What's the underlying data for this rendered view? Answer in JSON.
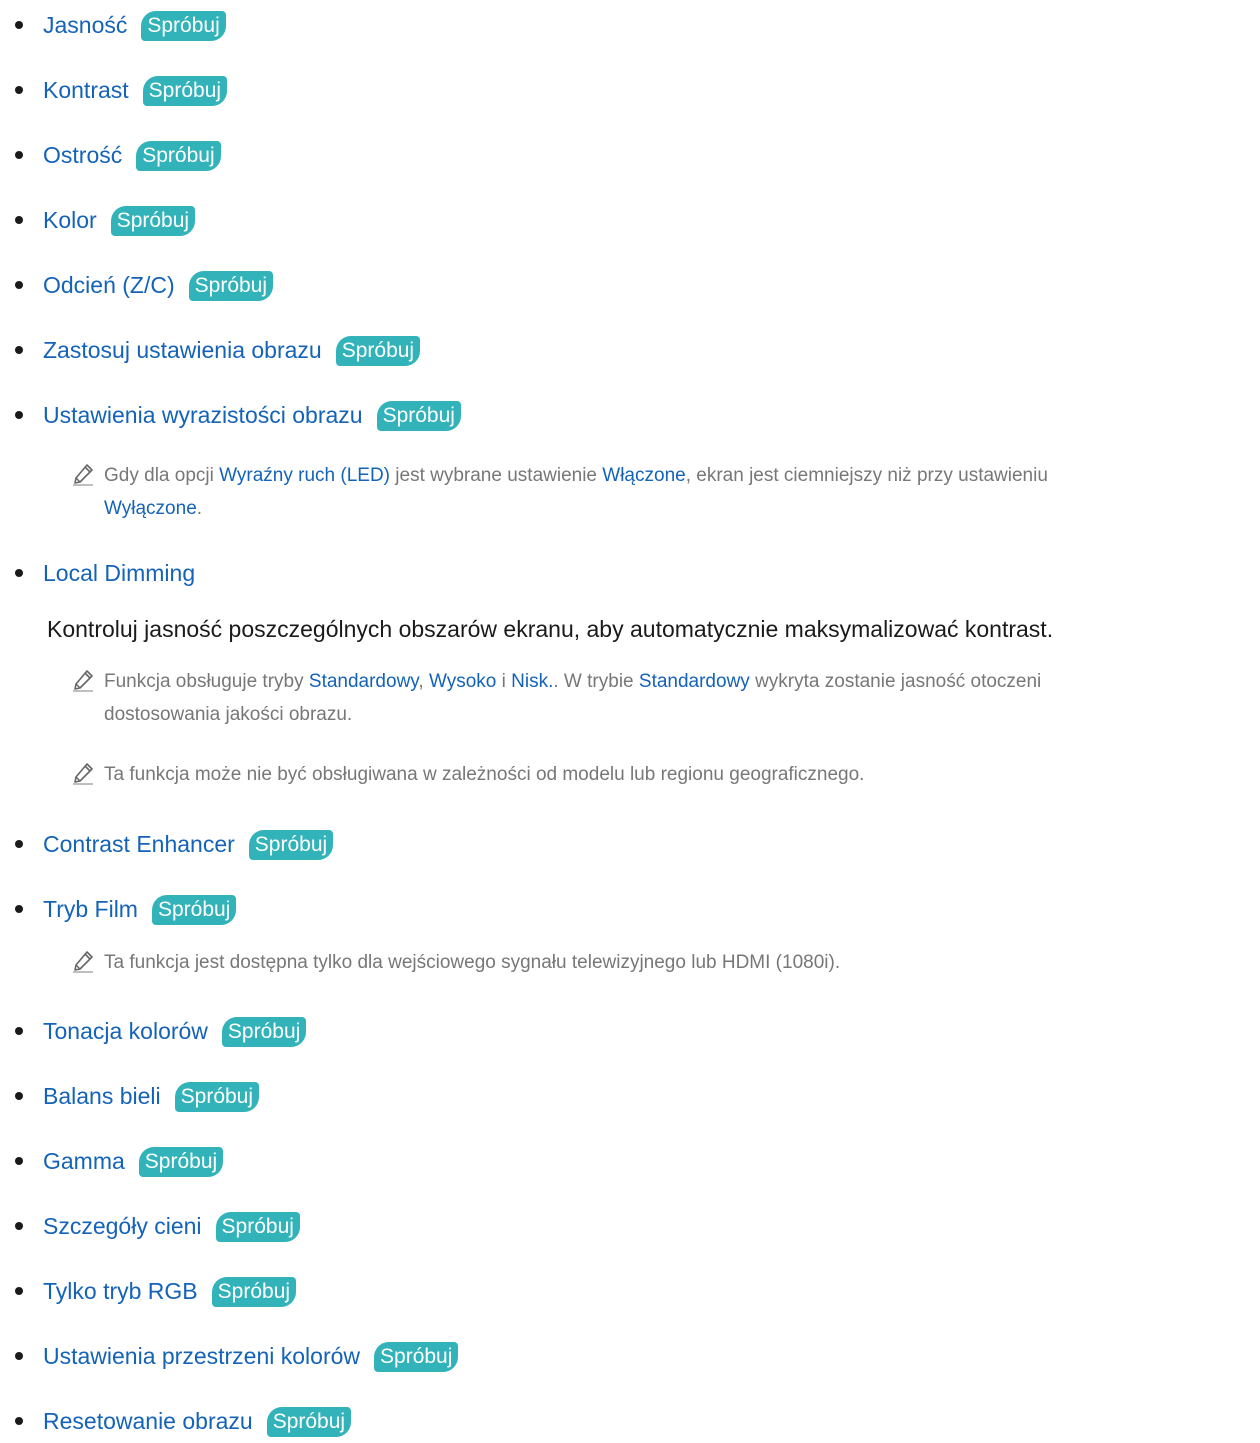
{
  "try_label": "Spróbuj",
  "items": [
    {
      "label": "Jasność"
    },
    {
      "label": "Kontrast"
    },
    {
      "label": "Ostrość"
    },
    {
      "label": "Kolor"
    },
    {
      "label": "Odcień (Z/C)"
    },
    {
      "label": "Zastosuj ustawienia obrazu"
    },
    {
      "label": "Ustawienia wyrazistości obrazu"
    },
    {
      "label": "Local Dimming"
    },
    {
      "label": "Contrast Enhancer"
    },
    {
      "label": "Tryb Film"
    },
    {
      "label": "Tonacja kolorów"
    },
    {
      "label": "Balans bieli"
    },
    {
      "label": "Gamma"
    },
    {
      "label": "Szczegóły cieni"
    },
    {
      "label": "Tylko tryb RGB"
    },
    {
      "label": "Ustawienia przestrzeni kolorów"
    },
    {
      "label": "Resetowanie obrazu"
    }
  ],
  "notes": {
    "clarity": {
      "t1": "Gdy dla opcji ",
      "k1": "Wyraźny ruch (LED)",
      "t2": " jest wybrane ustawienie ",
      "k2": "Włączone",
      "t3": ", ekran jest ciemniejszy niż przy ustawieniu",
      "k3": "Wyłączone",
      "t4": "."
    },
    "local_dimming_desc": "Kontroluj jasność poszczególnych obszarów ekranu, aby automatycznie maksymalizować kontrast.",
    "local_dimming_modes": {
      "t1": "Funkcja obsługuje tryby ",
      "k1": "Standardowy",
      "t2": ", ",
      "k2": "Wysoko",
      "t3": " i ",
      "k3": "Nisk.",
      "t4": ". W trybie ",
      "k4": "Standardowy",
      "t5": " wykryta zostanie jasność otoczeni",
      "t6": "dostosowania jakości obrazu."
    },
    "local_dimming_region": "Ta funkcja może nie być obsługiwana w zależności od modelu lub regionu geograficznego.",
    "film_mode": "Ta funkcja jest dostępna tylko dla wejściowego sygnału telewizyjnego lub HDMI (1080i)."
  }
}
